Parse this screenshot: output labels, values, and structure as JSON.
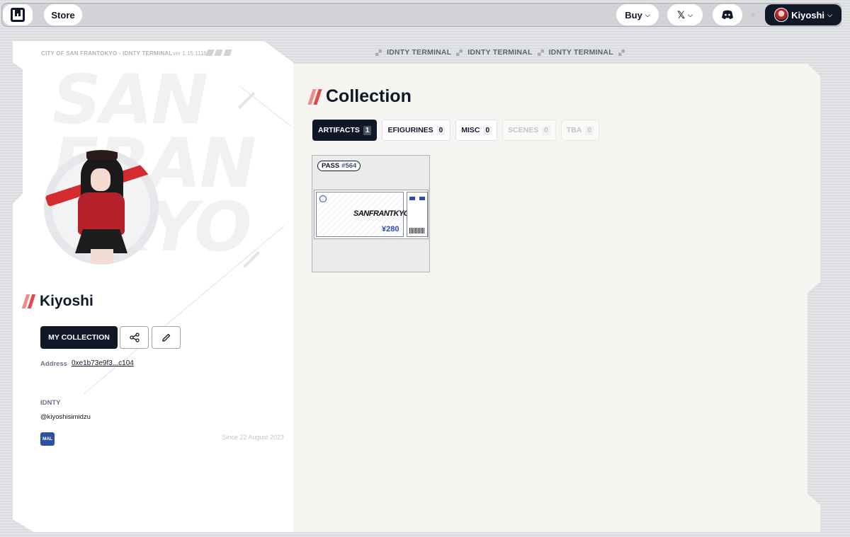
{
  "nav": {
    "store_label": "Store",
    "buy_label": "Buy",
    "user_label": "Kiyoshi"
  },
  "profile": {
    "header_text": "CITY OF SAN FRANTOKYO - IDNTY TERMINAL",
    "version": "ver 1.15.1116",
    "bg_text": "SAN FRAN TKYO",
    "name": "Kiyoshi",
    "my_collection_label": "MY COLLECTION",
    "address_label": "Address",
    "address_value": "0xe1b73e9f3...c104",
    "idnty_label": "IDNTY",
    "handle": "@kiyoshisimidzu",
    "badge_label": "MAL",
    "since": "Since 22 August 2023"
  },
  "terminal": {
    "labels": [
      "IDNTY TERMINAL",
      "IDNTY TERMINAL",
      "IDNTY TERMINAL"
    ]
  },
  "collection": {
    "title": "Collection",
    "tabs": [
      {
        "label": "ARTIFACTS",
        "count": "1",
        "state": "active"
      },
      {
        "label": "EFIGURINES",
        "count": "0",
        "state": "normal"
      },
      {
        "label": "MISC",
        "count": "0",
        "state": "normal"
      },
      {
        "label": "SCENES",
        "count": "0",
        "state": "disabled"
      },
      {
        "label": "TBA",
        "count": "0",
        "state": "disabled"
      }
    ],
    "items": [
      {
        "type_label": "PASS",
        "number": "#564",
        "ticket_logo": "SANFRANTKYO",
        "ticket_price": "¥280"
      }
    ]
  },
  "colors": {
    "primary": "#101828",
    "accent_red": "#e4484a",
    "badge_blue": "#2e51a2"
  }
}
